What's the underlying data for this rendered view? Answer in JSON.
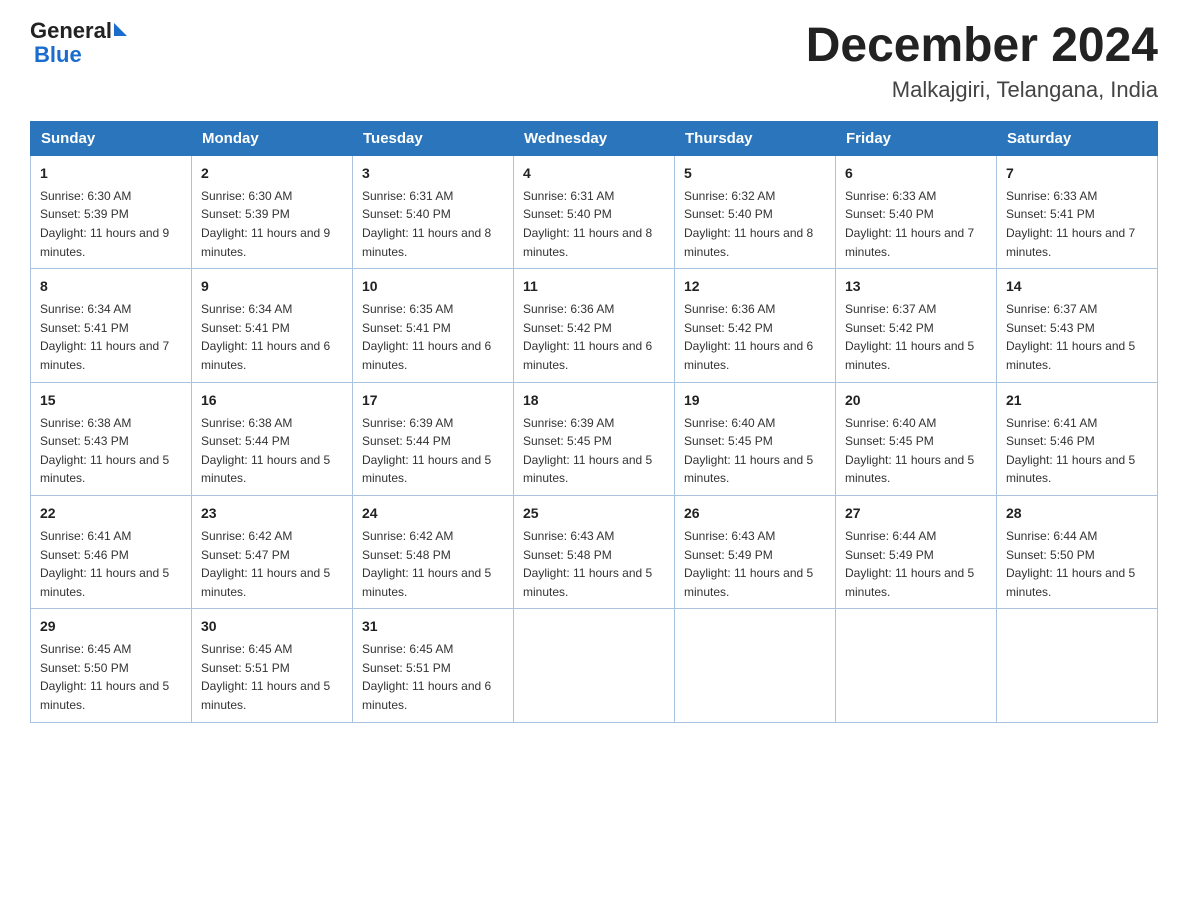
{
  "header": {
    "logo_general": "General",
    "logo_blue": "Blue",
    "month_title": "December 2024",
    "location": "Malkajgiri, Telangana, India"
  },
  "days_of_week": [
    "Sunday",
    "Monday",
    "Tuesday",
    "Wednesday",
    "Thursday",
    "Friday",
    "Saturday"
  ],
  "weeks": [
    [
      {
        "day": "1",
        "sunrise": "6:30 AM",
        "sunset": "5:39 PM",
        "daylight": "11 hours and 9 minutes."
      },
      {
        "day": "2",
        "sunrise": "6:30 AM",
        "sunset": "5:39 PM",
        "daylight": "11 hours and 9 minutes."
      },
      {
        "day": "3",
        "sunrise": "6:31 AM",
        "sunset": "5:40 PM",
        "daylight": "11 hours and 8 minutes."
      },
      {
        "day": "4",
        "sunrise": "6:31 AM",
        "sunset": "5:40 PM",
        "daylight": "11 hours and 8 minutes."
      },
      {
        "day": "5",
        "sunrise": "6:32 AM",
        "sunset": "5:40 PM",
        "daylight": "11 hours and 8 minutes."
      },
      {
        "day": "6",
        "sunrise": "6:33 AM",
        "sunset": "5:40 PM",
        "daylight": "11 hours and 7 minutes."
      },
      {
        "day": "7",
        "sunrise": "6:33 AM",
        "sunset": "5:41 PM",
        "daylight": "11 hours and 7 minutes."
      }
    ],
    [
      {
        "day": "8",
        "sunrise": "6:34 AM",
        "sunset": "5:41 PM",
        "daylight": "11 hours and 7 minutes."
      },
      {
        "day": "9",
        "sunrise": "6:34 AM",
        "sunset": "5:41 PM",
        "daylight": "11 hours and 6 minutes."
      },
      {
        "day": "10",
        "sunrise": "6:35 AM",
        "sunset": "5:41 PM",
        "daylight": "11 hours and 6 minutes."
      },
      {
        "day": "11",
        "sunrise": "6:36 AM",
        "sunset": "5:42 PM",
        "daylight": "11 hours and 6 minutes."
      },
      {
        "day": "12",
        "sunrise": "6:36 AM",
        "sunset": "5:42 PM",
        "daylight": "11 hours and 6 minutes."
      },
      {
        "day": "13",
        "sunrise": "6:37 AM",
        "sunset": "5:42 PM",
        "daylight": "11 hours and 5 minutes."
      },
      {
        "day": "14",
        "sunrise": "6:37 AM",
        "sunset": "5:43 PM",
        "daylight": "11 hours and 5 minutes."
      }
    ],
    [
      {
        "day": "15",
        "sunrise": "6:38 AM",
        "sunset": "5:43 PM",
        "daylight": "11 hours and 5 minutes."
      },
      {
        "day": "16",
        "sunrise": "6:38 AM",
        "sunset": "5:44 PM",
        "daylight": "11 hours and 5 minutes."
      },
      {
        "day": "17",
        "sunrise": "6:39 AM",
        "sunset": "5:44 PM",
        "daylight": "11 hours and 5 minutes."
      },
      {
        "day": "18",
        "sunrise": "6:39 AM",
        "sunset": "5:45 PM",
        "daylight": "11 hours and 5 minutes."
      },
      {
        "day": "19",
        "sunrise": "6:40 AM",
        "sunset": "5:45 PM",
        "daylight": "11 hours and 5 minutes."
      },
      {
        "day": "20",
        "sunrise": "6:40 AM",
        "sunset": "5:45 PM",
        "daylight": "11 hours and 5 minutes."
      },
      {
        "day": "21",
        "sunrise": "6:41 AM",
        "sunset": "5:46 PM",
        "daylight": "11 hours and 5 minutes."
      }
    ],
    [
      {
        "day": "22",
        "sunrise": "6:41 AM",
        "sunset": "5:46 PM",
        "daylight": "11 hours and 5 minutes."
      },
      {
        "day": "23",
        "sunrise": "6:42 AM",
        "sunset": "5:47 PM",
        "daylight": "11 hours and 5 minutes."
      },
      {
        "day": "24",
        "sunrise": "6:42 AM",
        "sunset": "5:48 PM",
        "daylight": "11 hours and 5 minutes."
      },
      {
        "day": "25",
        "sunrise": "6:43 AM",
        "sunset": "5:48 PM",
        "daylight": "11 hours and 5 minutes."
      },
      {
        "day": "26",
        "sunrise": "6:43 AM",
        "sunset": "5:49 PM",
        "daylight": "11 hours and 5 minutes."
      },
      {
        "day": "27",
        "sunrise": "6:44 AM",
        "sunset": "5:49 PM",
        "daylight": "11 hours and 5 minutes."
      },
      {
        "day": "28",
        "sunrise": "6:44 AM",
        "sunset": "5:50 PM",
        "daylight": "11 hours and 5 minutes."
      }
    ],
    [
      {
        "day": "29",
        "sunrise": "6:45 AM",
        "sunset": "5:50 PM",
        "daylight": "11 hours and 5 minutes."
      },
      {
        "day": "30",
        "sunrise": "6:45 AM",
        "sunset": "5:51 PM",
        "daylight": "11 hours and 5 minutes."
      },
      {
        "day": "31",
        "sunrise": "6:45 AM",
        "sunset": "5:51 PM",
        "daylight": "11 hours and 6 minutes."
      },
      null,
      null,
      null,
      null
    ]
  ]
}
